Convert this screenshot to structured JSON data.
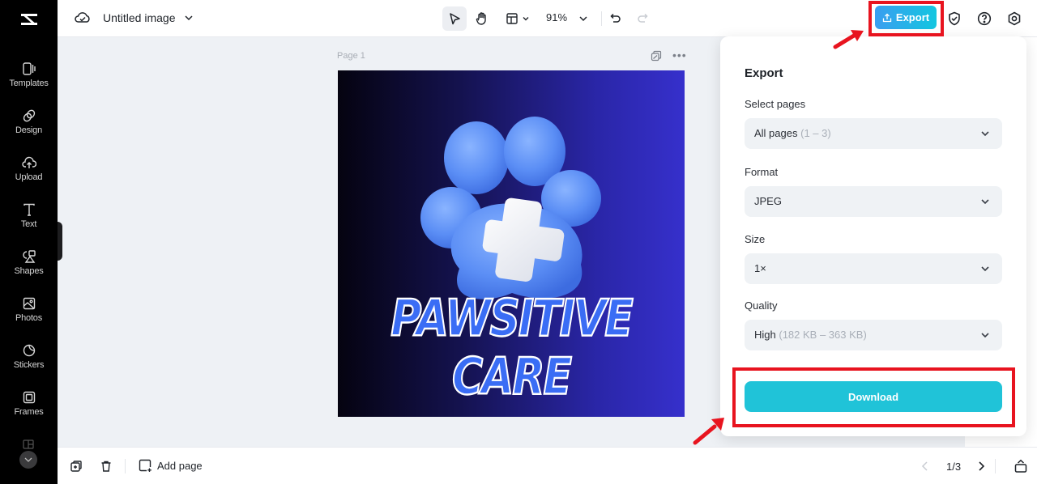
{
  "app": {
    "logo": "capcut-logo-icon"
  },
  "sidebar": {
    "items": [
      {
        "label": "Templates",
        "icon": "templates-icon"
      },
      {
        "label": "Design",
        "icon": "design-icon"
      },
      {
        "label": "Upload",
        "icon": "upload-icon"
      },
      {
        "label": "Text",
        "icon": "text-icon"
      },
      {
        "label": "Shapes",
        "icon": "shapes-icon"
      },
      {
        "label": "Photos",
        "icon": "photos-icon"
      },
      {
        "label": "Stickers",
        "icon": "stickers-icon"
      },
      {
        "label": "Frames",
        "icon": "frames-icon"
      }
    ],
    "more_icon": "chevron-down-icon"
  },
  "topbar": {
    "title": "Untitled image",
    "zoom": "91%",
    "export_label": "Export",
    "icons": [
      "cloud-save-icon",
      "select-pointer-icon",
      "hand-pan-icon",
      "layout-icon",
      "undo-icon",
      "redo-icon",
      "shield-check-icon",
      "help-icon",
      "settings-icon"
    ]
  },
  "canvas": {
    "page_label": "Page 1",
    "artwork_text": "PAWSITIVE CARE",
    "gradient_start": "#050310",
    "gradient_end": "#3630cc"
  },
  "export_panel": {
    "title": "Export",
    "select_pages_label": "Select pages",
    "select_pages_value": "All pages",
    "select_pages_range": "(1 – 3)",
    "format_label": "Format",
    "format_value": "JPEG",
    "size_label": "Size",
    "size_value": "1×",
    "quality_label": "Quality",
    "quality_value": "High",
    "quality_range": "(182 KB – 363 KB)",
    "download_label": "Download",
    "download_color": "#20c3d8"
  },
  "bottombar": {
    "add_page_label": "Add page",
    "pager": "1/3"
  },
  "annotations": {
    "highlight_color": "#e8141f"
  }
}
